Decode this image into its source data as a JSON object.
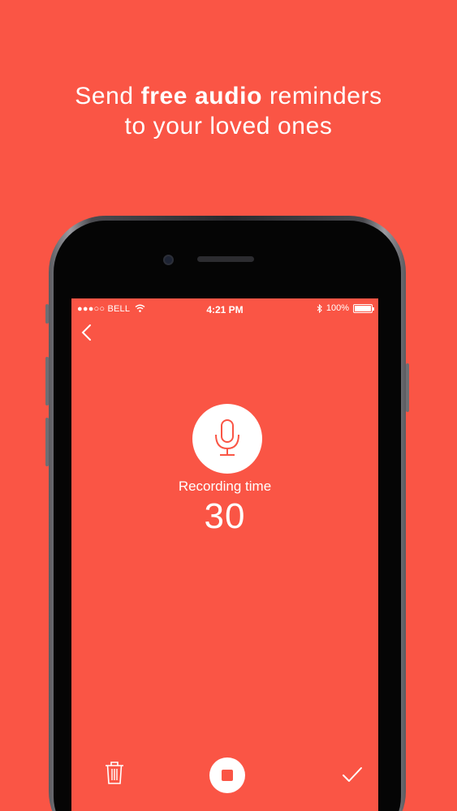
{
  "headline": {
    "line1_pre": "Send ",
    "line1_bold": "free audio",
    "line1_post": " reminders",
    "line2": "to your loved ones"
  },
  "status_bar": {
    "carrier": "●●●○○ BELL",
    "time": "4:21 PM",
    "battery_percent": "100%"
  },
  "recorder": {
    "label": "Recording time",
    "seconds": "30"
  },
  "icons": {
    "back": "chevron-left-icon",
    "mic": "microphone-icon",
    "trash": "trash-icon",
    "stop": "stop-icon",
    "confirm": "checkmark-icon",
    "wifi": "wifi-icon",
    "bluetooth": "bluetooth-icon",
    "battery": "battery-icon"
  },
  "colors": {
    "background": "#fa5545",
    "foreground": "#ffffff"
  }
}
